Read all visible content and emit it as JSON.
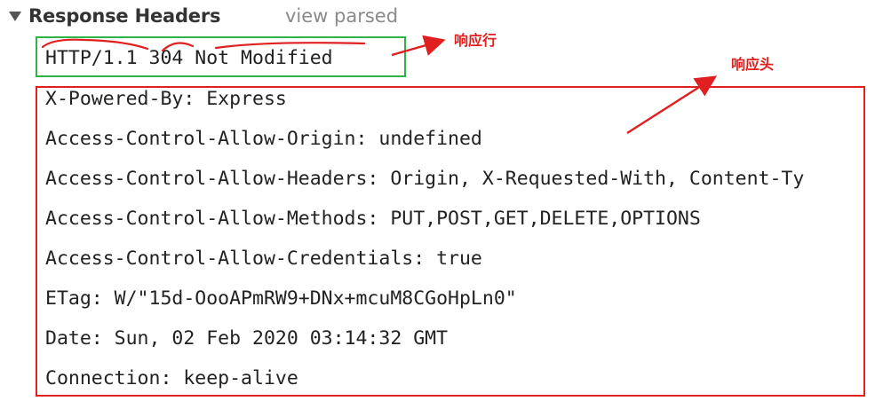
{
  "section": {
    "title": "Response Headers",
    "toggle_link": "view parsed"
  },
  "status_line": "HTTP/1.1 304 Not Modified",
  "headers": [
    "X-Powered-By: Express",
    "Access-Control-Allow-Origin: undefined",
    "Access-Control-Allow-Headers: Origin, X-Requested-With, Content-Ty",
    "Access-Control-Allow-Methods: PUT,POST,GET,DELETE,OPTIONS",
    "Access-Control-Allow-Credentials: true",
    "ETag: W/\"15d-OooAPmRW9+DNx+mcuM8CGoHpLn0\"",
    "Date: Sun, 02 Feb 2020 03:14:32 GMT",
    "Connection: keep-alive"
  ],
  "annotations": {
    "status_label": "响应行",
    "headers_label": "响应头"
  },
  "colors": {
    "status_box": "#2db34a",
    "headers_box": "#e02020",
    "annotation": "#e02020"
  }
}
